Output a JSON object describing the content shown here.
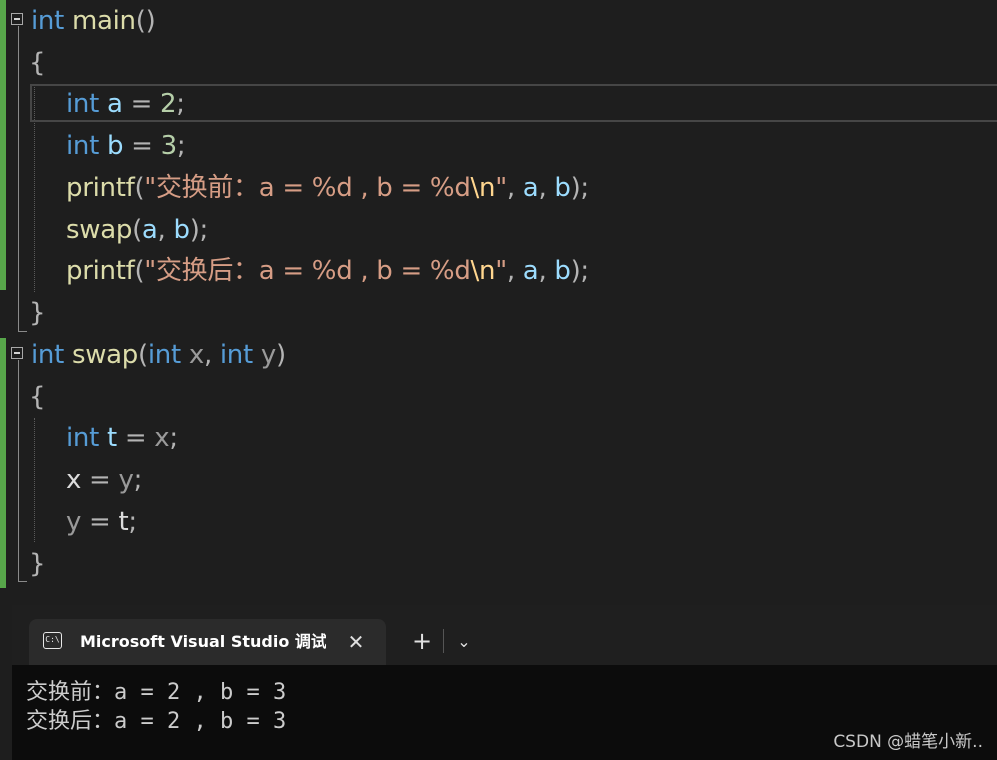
{
  "editor": {
    "main_sig": {
      "kw": "int",
      "name": "main",
      "parens": "()"
    },
    "brace_open": "{",
    "brace_close": "}",
    "main_body": {
      "line1": {
        "kw": "int",
        "var": "a",
        "op": " = ",
        "num": "2",
        "end": ";"
      },
      "line2": {
        "kw": "int",
        "var": "b",
        "op": " = ",
        "num": "3",
        "end": ";"
      },
      "line3": {
        "fn": "printf",
        "open": "(",
        "str": "\"交换前：a = %d , b = %d",
        "esc": "\\n",
        "strend": "\"",
        "c1": ", ",
        "a": "a",
        "c2": ", ",
        "b": "b",
        "close": ");"
      },
      "line4": {
        "fn": "swap",
        "open": "(",
        "a": "a",
        "c": ", ",
        "b": "b",
        "close": ");"
      },
      "line5": {
        "fn": "printf",
        "open": "(",
        "str": "\"交换后：a = %d , b = %d",
        "esc": "\\n",
        "strend": "\"",
        "c1": ", ",
        "a": "a",
        "c2": ", ",
        "b": "b",
        "close": ");"
      }
    },
    "swap_sig": {
      "kw": "int",
      "name": "swap",
      "open": "(",
      "kw2": "int",
      "p1": "x",
      "comma": ", ",
      "kw3": "int",
      "p2": "y",
      "close": ")"
    },
    "swap_body": {
      "line1": {
        "kw": "int",
        "var": "t",
        "op": " = ",
        "param": "x",
        "end": ";"
      },
      "line2": {
        "lhs": "x",
        "op": " = ",
        "rhs": "y",
        "end": ";"
      },
      "line3": {
        "lhs": "y",
        "op": " = ",
        "rhs": "t",
        "end": ";"
      }
    }
  },
  "terminal": {
    "tab_icon": "C:\\",
    "tab_title": "Microsoft Visual Studio 调试控制台",
    "close_glyph": "✕",
    "new_tab_glyph": "+",
    "dropdown_glyph": "⌄",
    "output": [
      "交换前：a = 2 , b = 3",
      "交换后：a = 2 , b = 3"
    ]
  },
  "watermark": "CSDN @蜡笔小新.."
}
